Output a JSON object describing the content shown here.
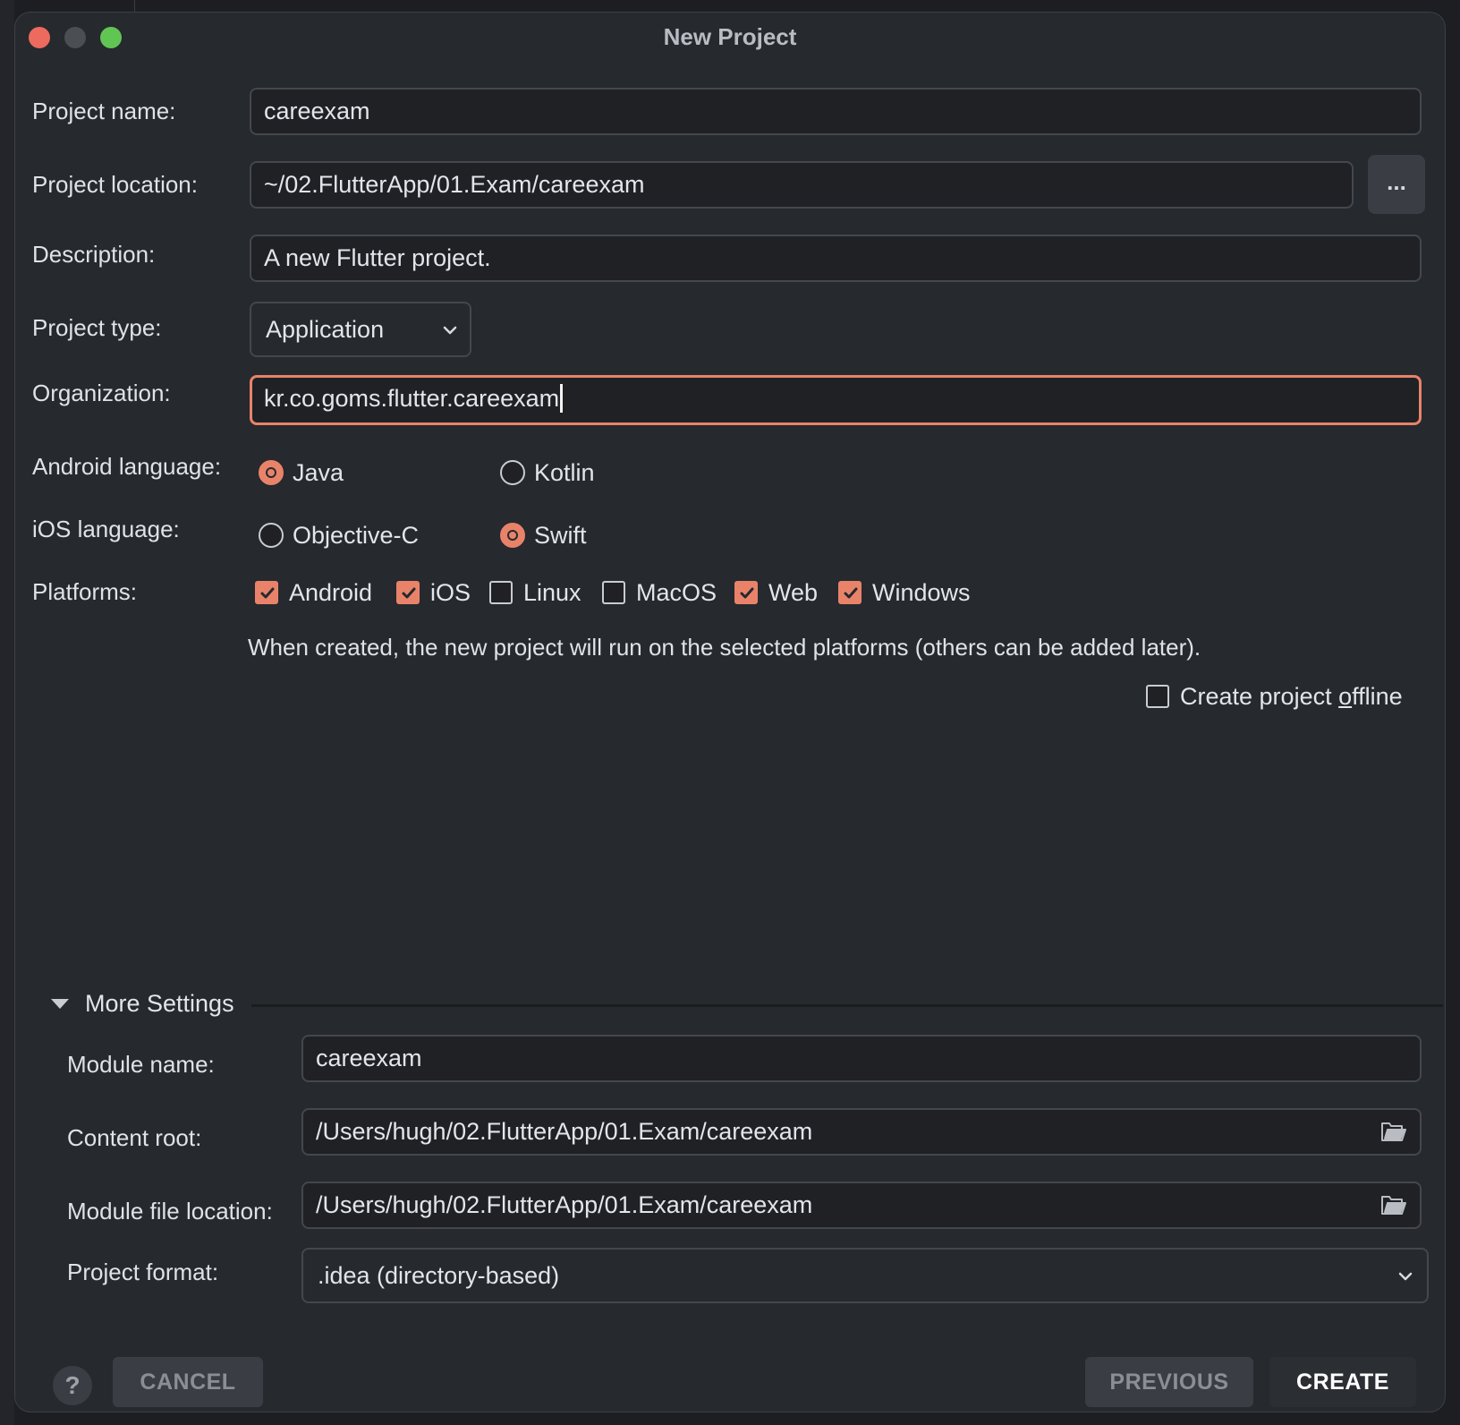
{
  "window": {
    "title": "New Project"
  },
  "form": {
    "project_name_label": "Project name:",
    "project_name_value": "careexam",
    "project_location_label": "Project location:",
    "project_location_value": "~/02.FlutterApp/01.Exam/careexam",
    "browse_label": "...",
    "description_label": "Description:",
    "description_value": "A new Flutter project.",
    "project_type_label": "Project type:",
    "project_type_value": "Application",
    "organization_label": "Organization:",
    "organization_value": "kr.co.goms.flutter.careexam",
    "android_language_label": "Android language:",
    "android_options": [
      {
        "label": "Java",
        "selected": true
      },
      {
        "label": "Kotlin",
        "selected": false
      }
    ],
    "ios_language_label": "iOS language:",
    "ios_options": [
      {
        "label": "Objective-C",
        "selected": false
      },
      {
        "label": "Swift",
        "selected": true
      }
    ],
    "platforms_label": "Platforms:",
    "platforms": [
      {
        "label": "Android",
        "checked": true
      },
      {
        "label": "iOS",
        "checked": true
      },
      {
        "label": "Linux",
        "checked": false
      },
      {
        "label": "MacOS",
        "checked": false
      },
      {
        "label": "Web",
        "checked": true
      },
      {
        "label": "Windows",
        "checked": true
      }
    ],
    "platforms_hint": "When created, the new project will run on the selected platforms (others can be added later).",
    "offline_label_pre": "Create project ",
    "offline_label_mnemonic": "o",
    "offline_label_post": "ffline",
    "offline_checked": false
  },
  "more_settings": {
    "toggle_label": "More Settings",
    "module_name_label": "Module name:",
    "module_name_value": "careexam",
    "content_root_label": "Content root:",
    "content_root_value": "/Users/hugh/02.FlutterApp/01.Exam/careexam",
    "module_file_label": "Module file location:",
    "module_file_value": "/Users/hugh/02.FlutterApp/01.Exam/careexam",
    "project_format_label": "Project format:",
    "project_format_value": ".idea (directory-based)"
  },
  "footer": {
    "help_label": "?",
    "cancel_label": "CANCEL",
    "previous_label": "PREVIOUS",
    "create_label": "CREATE"
  },
  "colors": {
    "accent": "#e8836a",
    "dialog_bg": "#26292e",
    "field_bg": "#1f2125",
    "button_bg": "#3a3e44"
  },
  "icons": {
    "dropdown": "chevron-down-icon",
    "folder": "folder-open-icon",
    "collapse": "triangle-down-icon"
  }
}
